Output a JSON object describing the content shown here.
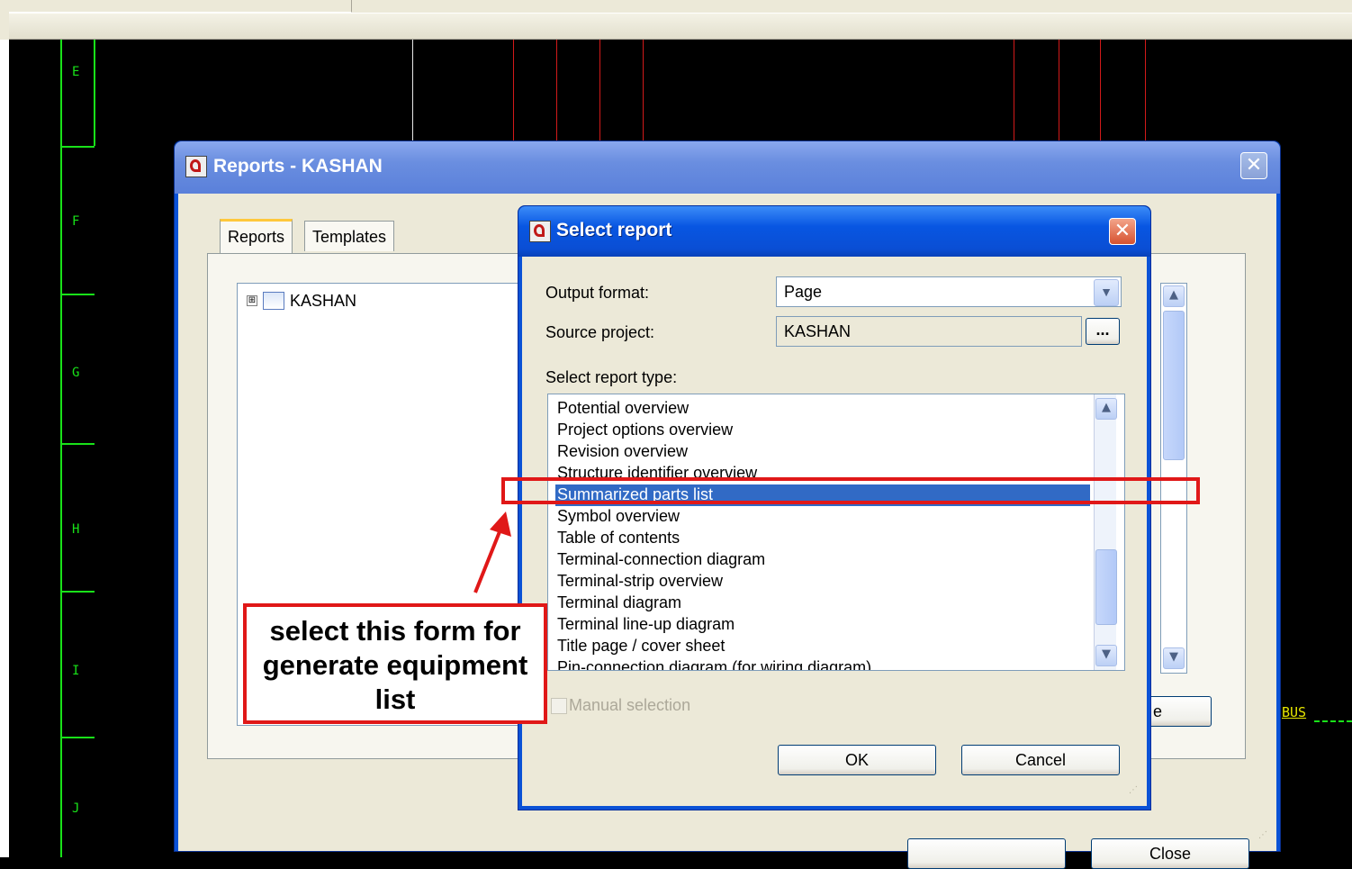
{
  "cad": {
    "rows": [
      "E",
      "F",
      "G",
      "H",
      "I",
      "J"
    ],
    "bus_label": "BUS"
  },
  "reports_window": {
    "title": "Reports - KASHAN",
    "close_glyph": "✕",
    "tabs": [
      {
        "label": "Reports"
      },
      {
        "label": "Templates"
      }
    ],
    "tree": {
      "expand_glyph": "⊞",
      "project": "KASHAN"
    },
    "buttons": {
      "partial_button_label": "e",
      "close_label": "Close"
    }
  },
  "select_report": {
    "title": "Select report",
    "close_glyph": "✕",
    "output_format": {
      "label": "Output format:",
      "value": "Page"
    },
    "source_project": {
      "label": "Source project:",
      "value": "KASHAN",
      "browse_label": "..."
    },
    "report_type_label": "Select report type:",
    "report_types": [
      "Potential overview",
      "Project options overview",
      "Revision overview",
      "Structure identifier overview",
      "Summarized parts list",
      "Symbol overview",
      "Table of contents",
      "Terminal-connection diagram",
      "Terminal-strip overview",
      "Terminal diagram",
      "Terminal line-up diagram",
      "Title page / cover sheet",
      "Pin-connection diagram (for wiring diagram)"
    ],
    "selected_report_type": "Summarized parts list",
    "manual_selection_label": "Manual selection",
    "manual_selection_checked": false,
    "ok_label": "OK",
    "cancel_label": "Cancel"
  },
  "annotation": {
    "callout_text": "select this form for generate equipment list",
    "colors": {
      "border": "#e01818",
      "selection": "#316ac5"
    }
  }
}
